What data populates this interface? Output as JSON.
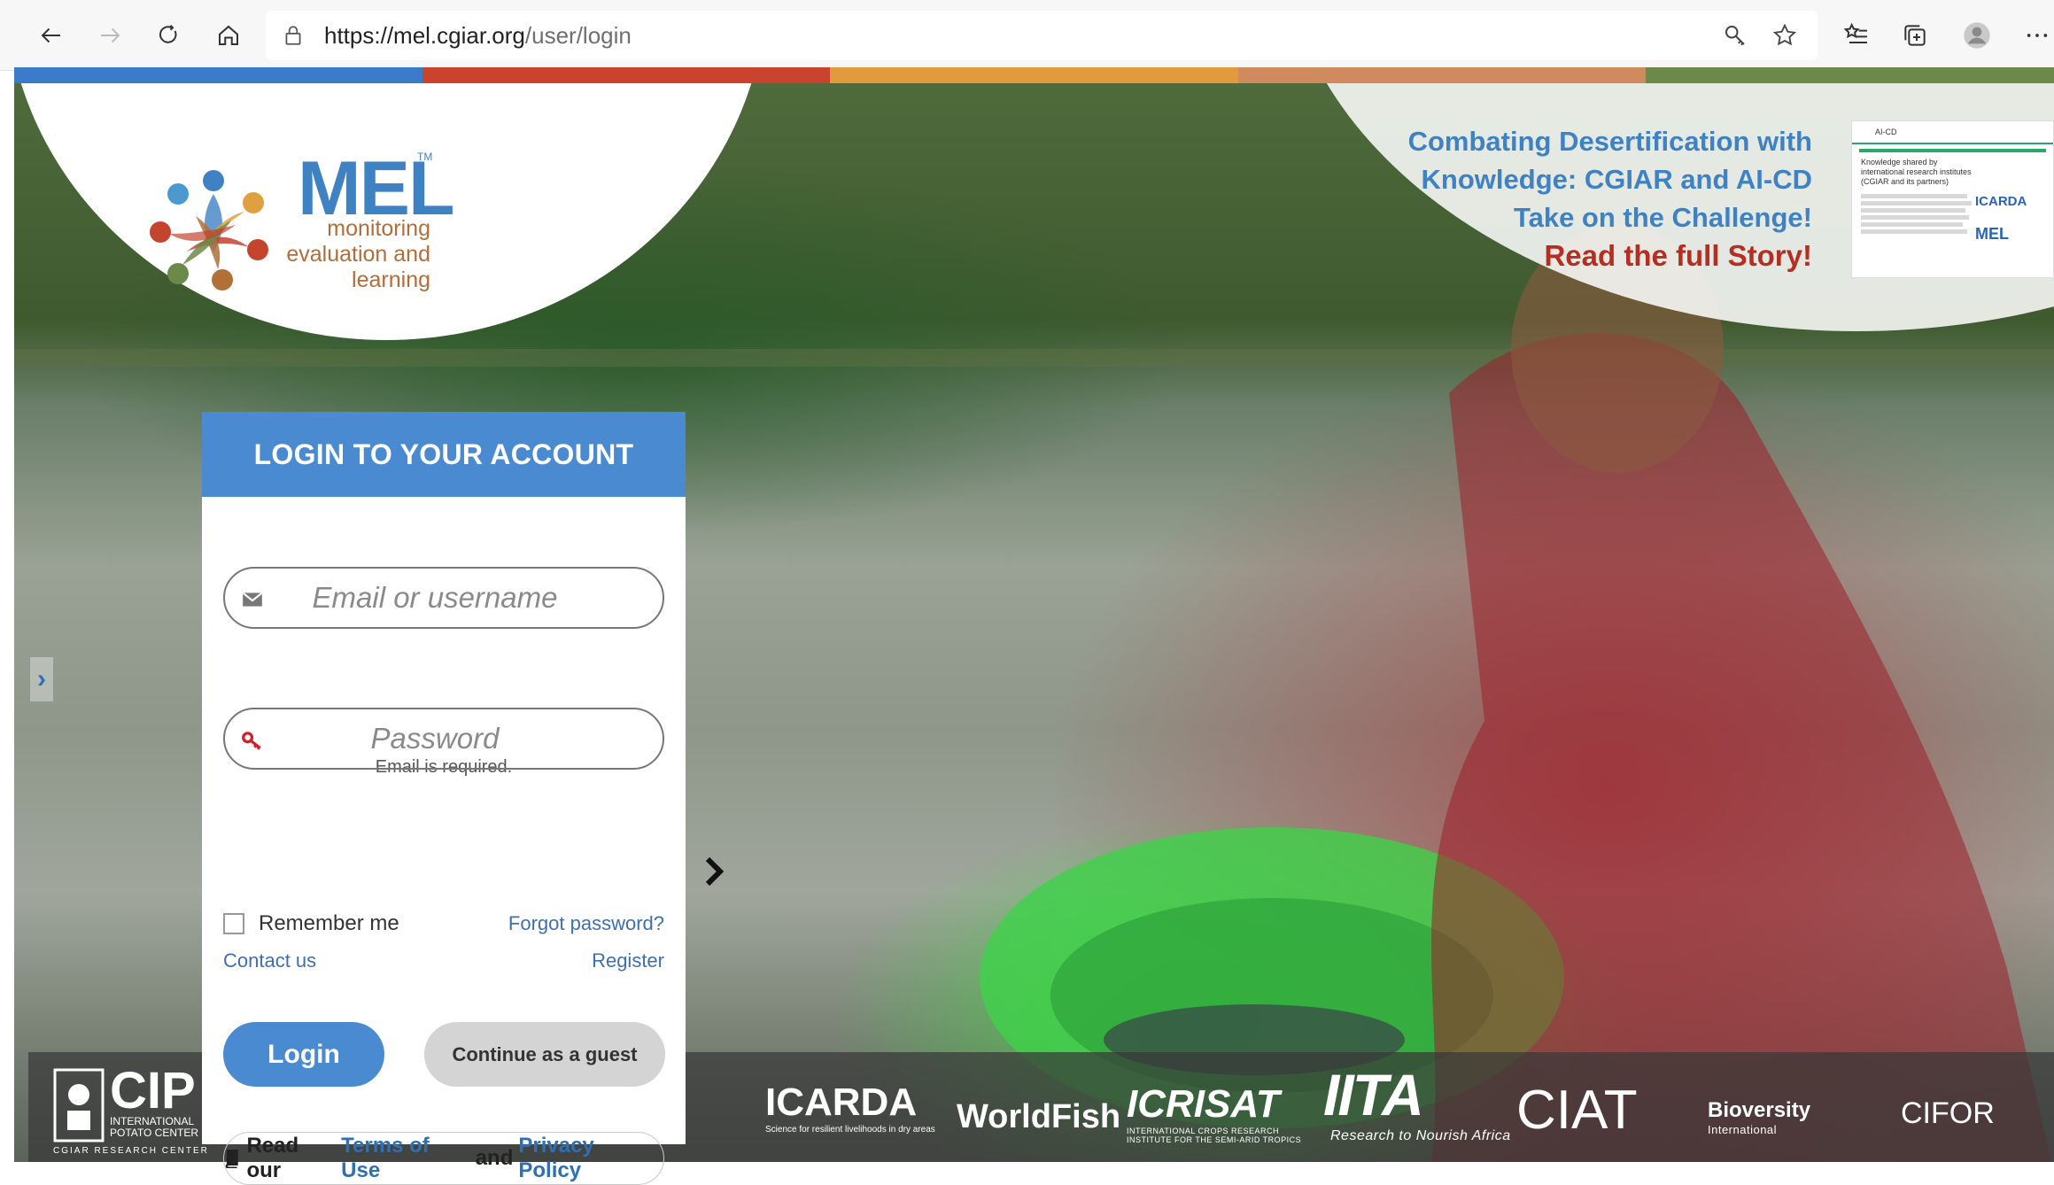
{
  "browser": {
    "url_domain": "https://mel.cgiar.org",
    "url_path": "/user/login",
    "icons": [
      "back-icon",
      "forward-icon",
      "refresh-icon",
      "home-icon",
      "lock-icon",
      "key-icon",
      "star-icon",
      "favorites-icon",
      "collections-icon",
      "profile-icon",
      "more-icon"
    ]
  },
  "stripe_colors": [
    "#3a7cc9",
    "#c9432e",
    "#e19a3c",
    "#cf8a5e",
    "#6b8a4a"
  ],
  "logo": {
    "title": "MEL",
    "tm": "TM",
    "sub_line1": "monitoring",
    "sub_line2": "evaluation and",
    "sub_line3": "learning"
  },
  "story": {
    "line1": "Combating Desertification with",
    "line2": "Knowledge: CGIAR and AI-CD",
    "line3": "Take on the Challenge!",
    "cta": "Read the full Story!",
    "thumb_title": "AI-CD",
    "thumb_heading": "Knowledge shared by international research institutes (CGIAR and its partners)",
    "thumb_logo1": "ICARDA",
    "thumb_logo2": "MEL"
  },
  "login": {
    "header": "LOGIN TO YOUR ACCOUNT",
    "email_placeholder": "Email or username",
    "email_error": "Email is required.",
    "password_placeholder": "Password",
    "remember_label": "Remember me",
    "forgot_label": "Forgot password?",
    "contact_label": "Contact us",
    "register_label": "Register",
    "login_button": "Login",
    "guest_button": "Continue as a guest",
    "terms_prefix": "Read our",
    "terms_link": "Terms of Use",
    "terms_and": "and",
    "privacy_link": "Privacy Policy"
  },
  "partners": {
    "cip": "CIP",
    "cip_sub1": "INTERNATIONAL",
    "cip_sub2": "POTATO CENTER",
    "cip_sub3": "CGIAR RESEARCH CENTER",
    "icarda": "ICARDA",
    "icarda_sub": "Science for resilient livelihoods in dry areas",
    "worldfish": "WorldFish",
    "icrisat": "ICRISAT",
    "icrisat_sub1": "INTERNATIONAL CROPS RESEARCH",
    "icrisat_sub2": "INSTITUTE FOR THE SEMI-ARID TROPICS",
    "iita": "IITA",
    "iita_sub": "Research to Nourish Africa",
    "ciat": "CIAT",
    "bioversity": "Bioversity",
    "bioversity_sub": "International",
    "cifor": "CIFOR"
  }
}
